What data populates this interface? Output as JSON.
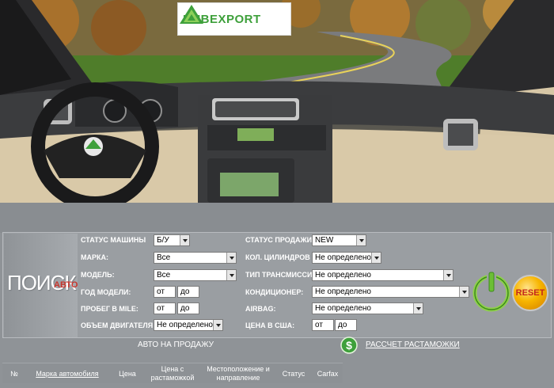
{
  "logo": {
    "brand": "HUBEXPORT"
  },
  "search": {
    "title": "ПОИСК",
    "subtitle": "АВТО"
  },
  "fields": {
    "car_status": {
      "label": "СТАТУС МАШИНЫ",
      "value": "Б/У"
    },
    "sale_status": {
      "label": "СТАТУС ПРОДАЖИ",
      "value": "NEW"
    },
    "make": {
      "label": "МАРКА:",
      "value": "Все"
    },
    "cylinders": {
      "label": "КОЛ. ЦИЛИНДРОВ",
      "value": "Не определено"
    },
    "model": {
      "label": "МОДЕЛЬ:",
      "value": "Все"
    },
    "transmission": {
      "label": "ТИП ТРАНСМИССИИ:",
      "value": "Не определено"
    },
    "year": {
      "label": "ГОД МОДЕЛИ:",
      "from": "от",
      "to": "до"
    },
    "air_conditioner": {
      "label": "КОНДИЦИОНЕР:",
      "value": "Не определено"
    },
    "mileage": {
      "label": "ПРОБЕГ В MILE:",
      "from": "от",
      "to": "до"
    },
    "airbag": {
      "label": "AIRBAG:",
      "value": "Не определено"
    },
    "engine_volume": {
      "label": "ОБЪЕМ ДВИГАТЕЛЯ:",
      "value": "Не определено"
    },
    "price_usa": {
      "label": "ЦЕНА В США:",
      "from": "от",
      "to": "до"
    }
  },
  "buttons": {
    "reset": "RESET",
    "power_icon": "power-icon"
  },
  "links": {
    "cars_for_sale": "АВТО НА ПРОДАЖУ",
    "customs_calc": "РАССЧЕТ РАСТАМОЖКИ"
  },
  "table": {
    "headers": [
      "№",
      "Марка автомобиля",
      "Цена",
      "Цена с растаможкой",
      "Местоположение и направление",
      "Статус",
      "Carfax"
    ]
  },
  "colors": {
    "panel": "#9a9ea2",
    "accent_green": "#3ea03b",
    "reset_text": "#c3261c"
  }
}
